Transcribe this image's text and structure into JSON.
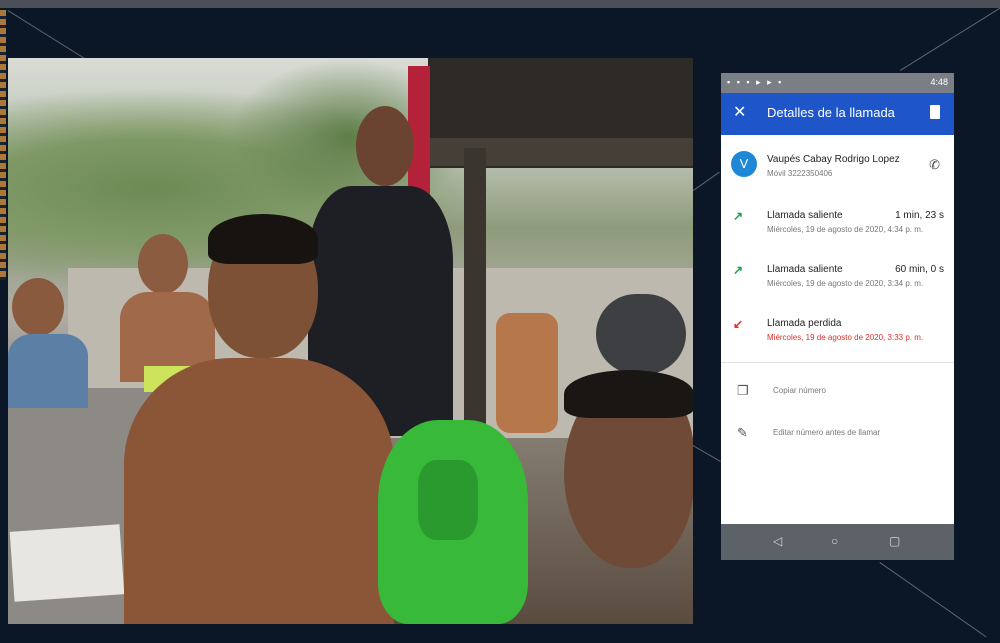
{
  "phone": {
    "status_bar": {
      "time": "4:48"
    },
    "app_bar": {
      "close_icon": "close-icon",
      "title": "Detalles de la llamada",
      "delete_icon": "trash-icon",
      "color": "#1e56c9"
    },
    "contact": {
      "avatar_letter": "V",
      "name": "Vaupés Cabay Rodrigo Lopez",
      "number": "Móvil 3222350406",
      "call_icon": "phone-icon"
    },
    "calls": [
      {
        "type": "Llamada saliente",
        "duration": "1 min, 23 s",
        "date": "Miércoles, 19 de agosto de 2020, 4:34 p. m.",
        "icon": "outgoing-arrow-icon",
        "color": "#1a9e4a"
      },
      {
        "type": "Llamada saliente",
        "duration": "60 min, 0 s",
        "date": "Miércoles, 19 de agosto de 2020, 3:34 p. m.",
        "icon": "outgoing-arrow-icon",
        "color": "#1a9e4a"
      },
      {
        "type": "Llamada perdida",
        "duration": "",
        "date": "Miércoles, 19 de agosto de 2020, 3:33 p. m.",
        "icon": "missed-call-icon",
        "color": "#d9312b"
      }
    ],
    "actions": [
      {
        "label": "Copiar número",
        "icon": "copy-icon"
      },
      {
        "label": "Editar número antes de llamar",
        "icon": "edit-icon"
      }
    ],
    "nav": [
      "back-icon",
      "home-icon",
      "recents-icon"
    ]
  }
}
